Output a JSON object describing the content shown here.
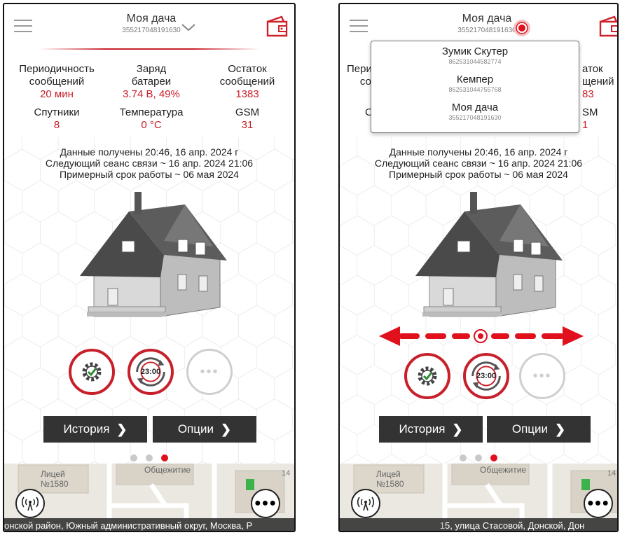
{
  "left": {
    "header": {
      "title": "Моя дача",
      "device_id": "355217048191630"
    },
    "stats": [
      {
        "label1": "Периодичность",
        "label2": "сообщений",
        "value": "20 мин"
      },
      {
        "label1": "Заряд",
        "label2": "батареи",
        "value": "3.74 В, 49%"
      },
      {
        "label1": "Остаток",
        "label2": "сообщений",
        "value": "1383"
      },
      {
        "label1": "Спутники",
        "value": "8"
      },
      {
        "label1": "Температура",
        "value": "0 °С"
      },
      {
        "label1": "GSM",
        "value": "31"
      }
    ],
    "info": [
      "Данные получены 20:46, 16 апр. 2024 г",
      "Следующий сеанс связи ~ 16 апр. 2024 21:06",
      "Примерный срок работы ~ 06 мая 2024"
    ],
    "schedule_time": "23:00",
    "buttons": {
      "history": "История",
      "options": "Опции",
      "chev": "❯"
    },
    "map": {
      "label1": "Лицей",
      "label2": "№1580",
      "label3": "Общежитие",
      "house_no": "14",
      "address": "онской район, Южный административный округ, Москва, Р"
    }
  },
  "right": {
    "header": {
      "title": "Моя дача",
      "device_id": "355217048191630"
    },
    "dropdown": [
      {
        "name": "Зумик Скутер",
        "id": "862531044582774"
      },
      {
        "name": "Кемпер",
        "id": "862531044755768"
      },
      {
        "name": "Моя дача",
        "id": "355217048191630"
      }
    ],
    "stats_partial": {
      "a": "Пери",
      "b": "со",
      "c": "С",
      "d": "аток",
      "e": "щений",
      "f": "83",
      "g": "SM",
      "h": "1"
    },
    "info": [
      "Данные получены 20:46, 16 апр. 2024 г",
      "Следующий сеанс связи ~ 16 апр. 2024 21:06",
      "Примерный срок работы ~ 06 мая 2024"
    ],
    "schedule_time": "23:00",
    "buttons": {
      "history": "История",
      "options": "Опции",
      "chev": "❯"
    },
    "map": {
      "label1": "Лицей",
      "label2": "№1580",
      "label3": "Общежитие",
      "house_no": "14",
      "addr_prefix": "1",
      "address": "5, улица Стасовой, Донской, Дон"
    }
  },
  "colors": {
    "accent": "#c8202a",
    "dark_button": "#333333",
    "dot_active": "#e0101c"
  },
  "page": {
    "active_dot": 3,
    "dot_count": 3
  }
}
